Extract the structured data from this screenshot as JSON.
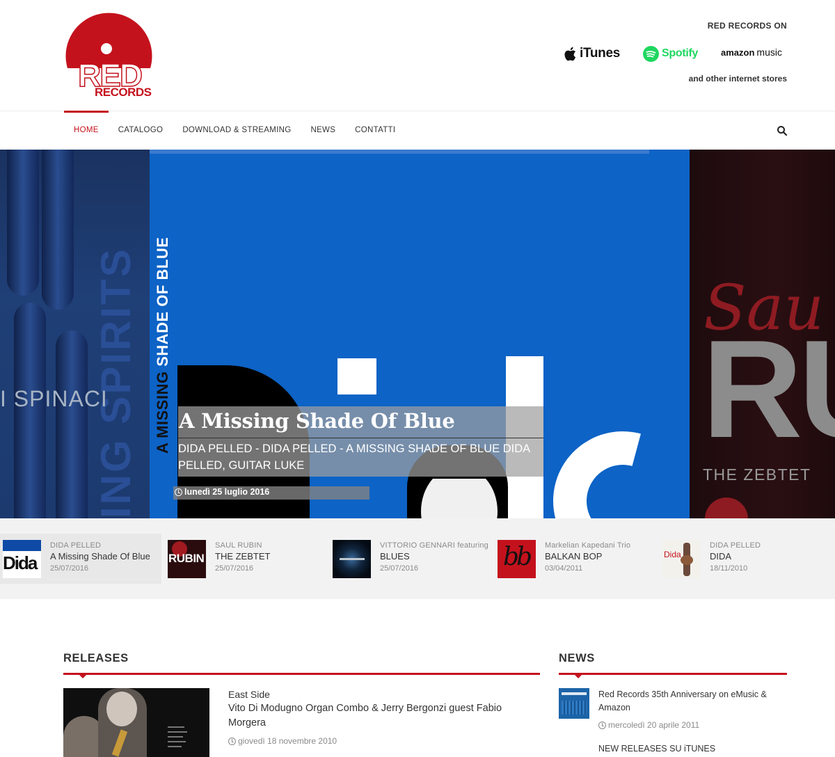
{
  "brand": {
    "logo_main": "RED",
    "logo_sub": "RECORDS",
    "accent": "#c4121d"
  },
  "stores": {
    "title": "RED RECORDS ON",
    "itunes": "iTunes",
    "spotify": "Spotify",
    "amazon": "amazon",
    "amazon_music": "music",
    "other": "and other internet stores"
  },
  "nav": {
    "items": [
      "HOME",
      "CATALOGO",
      "DOWNLOAD & STREAMING",
      "NEWS",
      "CONTATTI"
    ],
    "active": "HOME",
    "search_icon": "search-icon"
  },
  "hero": {
    "left_cover": {
      "vertical_text": "ING SPIRITS",
      "artist": "I SPINACI"
    },
    "current": {
      "vertical_title_light": "SHADE OF BLUE",
      "vertical_title_dark": "A MISSING",
      "title": "A Missing Shade Of Blue",
      "excerpt": "DIDA PELLED - DIDA PELLED - A MISSING SHADE OF BLUE DIDA PELLED, GUITAR LUKE",
      "date": "lunedì 25 luglio 2016"
    },
    "right_cover": {
      "big_text": "RU",
      "script": "Sau",
      "subtitle": "THE ZEBTET"
    }
  },
  "thumbnails": [
    {
      "artist": "DIDA PELLED",
      "title": "A Missing Shade Of Blue",
      "date": "25/07/2016",
      "cover_text": "Dida"
    },
    {
      "artist": "SAUL RUBIN",
      "title": "THE ZEBTET",
      "date": "25/07/2016",
      "cover_text": "RUBIN"
    },
    {
      "artist": "VITTORIO GENNARI featuring",
      "title": "BLUES",
      "date": "25/07/2016",
      "cover_text": ""
    },
    {
      "artist": "Markelian Kapedani Trio",
      "title": "BALKAN BOP",
      "date": "03/04/2011",
      "cover_text": "bb"
    },
    {
      "artist": "DIDA PELLED",
      "title": "DIDA",
      "date": "18/11/2010",
      "cover_text": "Dida"
    }
  ],
  "releases": {
    "heading": "RELEASES",
    "item": {
      "category": "East Side",
      "title": "Vito Di Modugno Organ Combo & Jerry Bergonzi guest Fabio Morgera",
      "date": "giovedì 18 novembre 2010"
    }
  },
  "news": {
    "heading": "NEWS",
    "items": [
      {
        "title": "Red Records 35th Anniversary on eMusic & Amazon",
        "date": "mercoledì 20 aprile 2011"
      },
      {
        "title": "NEW RELEASES SU iTUNES"
      }
    ]
  }
}
